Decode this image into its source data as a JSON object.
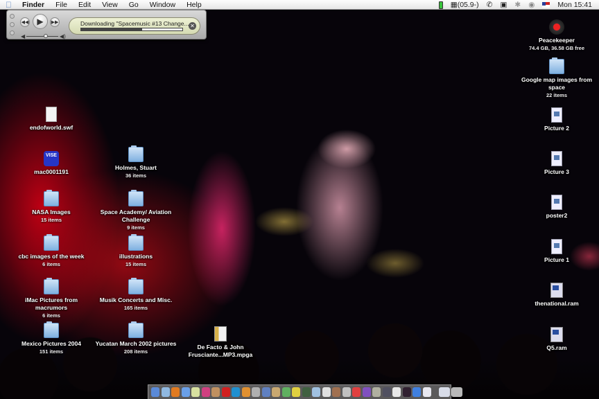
{
  "menubar": {
    "app": "Finder",
    "items": [
      "File",
      "Edit",
      "View",
      "Go",
      "Window",
      "Help"
    ],
    "extras": {
      "status": "(05.9-)",
      "clock": "Mon 15:41"
    }
  },
  "player": {
    "status_text": "Downloading \"Spacemusic #13 Change...",
    "progress": 0.6
  },
  "desktop_left": [
    {
      "name": "endofworld.swf",
      "type": "doc"
    },
    {
      "name": "mac0001191",
      "type": "vise",
      "badge": "VISE"
    },
    {
      "name": "NASA Images",
      "sub": "15 items",
      "type": "folder"
    },
    {
      "name": "cbc images of the week",
      "sub": "6 items",
      "type": "folder"
    },
    {
      "name": "iMac Pictures from macrumors",
      "sub": "6 items",
      "type": "folder"
    },
    {
      "name": "Mexico Pictures 2004",
      "sub": "151 items",
      "type": "folder"
    }
  ],
  "desktop_mid": [
    {
      "name": "Holmes, Stuart",
      "sub": "36 items",
      "type": "folder"
    },
    {
      "name": "Space Academy/ Aviation Challenge",
      "sub": "9 items",
      "type": "folder"
    },
    {
      "name": "illustrations",
      "sub": "15 items",
      "type": "folder"
    },
    {
      "name": "Musik Concerts and Misc.",
      "sub": "165 items",
      "type": "folder"
    },
    {
      "name": "Yucatan March 2002 pictures",
      "sub": "208 items",
      "type": "folder"
    },
    {
      "name": "De Facto & John Frusciante...MP3.mpga",
      "type": "mp3"
    }
  ],
  "desktop_right": [
    {
      "name": "Peacekeeper",
      "sub": "74.4 GB, 36.58 GB free",
      "type": "disk"
    },
    {
      "name": "Google map images from space",
      "sub": "22 items",
      "type": "folder"
    },
    {
      "name": "Picture 2",
      "type": "pic"
    },
    {
      "name": "Picture 3",
      "type": "pic"
    },
    {
      "name": "poster2",
      "type": "pic"
    },
    {
      "name": "Picture 1",
      "type": "pic"
    },
    {
      "name": "thenational.ram",
      "type": "ram"
    },
    {
      "name": "Q5.ram",
      "type": "ram"
    }
  ],
  "dock": {
    "apps": [
      {
        "icon": "finder-icon",
        "color": "#5a8ad8"
      },
      {
        "icon": "safari-icon",
        "color": "#8fb8e0"
      },
      {
        "icon": "firefox-icon",
        "color": "#e07a20"
      },
      {
        "icon": "app-icon",
        "color": "#6aa0e8"
      },
      {
        "icon": "textedit-icon",
        "color": "#d8e0a0"
      },
      {
        "icon": "photo-icon",
        "color": "#d04080"
      },
      {
        "icon": "mail-icon",
        "color": "#c09060"
      },
      {
        "icon": "app-red-icon",
        "color": "#d02020"
      },
      {
        "icon": "app-blue-icon",
        "color": "#2090d0"
      },
      {
        "icon": "app-orange-icon",
        "color": "#e09030"
      },
      {
        "icon": "app-grey-icon",
        "color": "#b0b0b0"
      },
      {
        "icon": "preview-icon",
        "color": "#6080c0"
      },
      {
        "icon": "app-tan-icon",
        "color": "#c8a870"
      },
      {
        "icon": "itunes-icon",
        "color": "#60b060"
      },
      {
        "icon": "app-yellow-icon",
        "color": "#e0d040"
      },
      {
        "icon": "app-dark-icon",
        "color": "#406040"
      },
      {
        "icon": "monitor-icon",
        "color": "#a0c0e0"
      },
      {
        "icon": "app-white-icon",
        "color": "#e0e0e0"
      },
      {
        "icon": "iphoto-icon",
        "color": "#a07050"
      },
      {
        "icon": "app-silver-icon",
        "color": "#c0c0c0"
      },
      {
        "icon": "ical-icon",
        "color": "#e04040"
      },
      {
        "icon": "dvd-icon",
        "color": "#8050c0"
      },
      {
        "icon": "calculator-icon",
        "color": "#b0b0a0"
      },
      {
        "icon": "utility-icon",
        "color": "#505060"
      },
      {
        "icon": "ipod-icon",
        "color": "#e8e8e8"
      },
      {
        "icon": "app-black-icon",
        "color": "#302030"
      },
      {
        "icon": "app-globe-icon",
        "color": "#4080e0"
      },
      {
        "icon": "app-list-icon",
        "color": "#e8e8f0"
      }
    ],
    "docs": [
      {
        "icon": "document-icon",
        "color": "#d8dce8"
      },
      {
        "icon": "trash-icon",
        "color": "#b8b8b8"
      }
    ]
  }
}
